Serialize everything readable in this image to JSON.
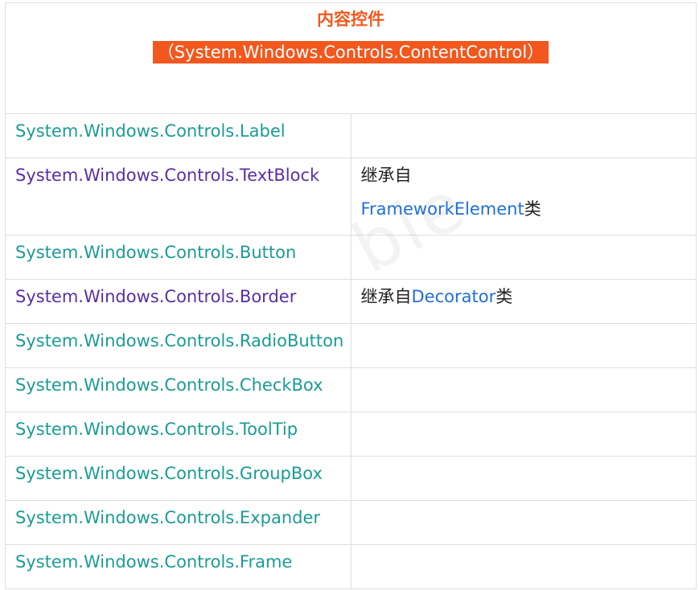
{
  "header": {
    "title": "内容控件",
    "subtitle": "（System.Windows.Controls.ContentControl）"
  },
  "watermark": "ble",
  "colors": {
    "accent_orange": "#f2581e",
    "teal_text": "#1a9c94",
    "purple_text": "#5a2fa5",
    "link_blue": "#1e6fd9"
  },
  "rows": [
    {
      "name": "System.Windows.Controls.Label",
      "note_prefix": "",
      "note_link": "",
      "note_suffix": ""
    },
    {
      "name": "System.Windows.Controls.TextBlock",
      "note_prefix": "继承自",
      "note_link": "FrameworkElement",
      "note_suffix": "类"
    },
    {
      "name": "System.Windows.Controls.Button",
      "note_prefix": "",
      "note_link": "",
      "note_suffix": ""
    },
    {
      "name": "System.Windows.Controls.Border",
      "note_prefix": "继承自",
      "note_link": "Decorator",
      "note_suffix": "类"
    },
    {
      "name": "System.Windows.Controls.RadioButton",
      "note_prefix": "",
      "note_link": "",
      "note_suffix": ""
    },
    {
      "name": "System.Windows.Controls.CheckBox",
      "note_prefix": "",
      "note_link": "",
      "note_suffix": ""
    },
    {
      "name": "System.Windows.Controls.ToolTip",
      "note_prefix": "",
      "note_link": "",
      "note_suffix": ""
    },
    {
      "name": "System.Windows.Controls.GroupBox",
      "note_prefix": "",
      "note_link": "",
      "note_suffix": ""
    },
    {
      "name": "System.Windows.Controls.Expander",
      "note_prefix": "",
      "note_link": "",
      "note_suffix": ""
    },
    {
      "name": "System.Windows.Controls.Frame",
      "note_prefix": "",
      "note_link": "",
      "note_suffix": ""
    }
  ]
}
